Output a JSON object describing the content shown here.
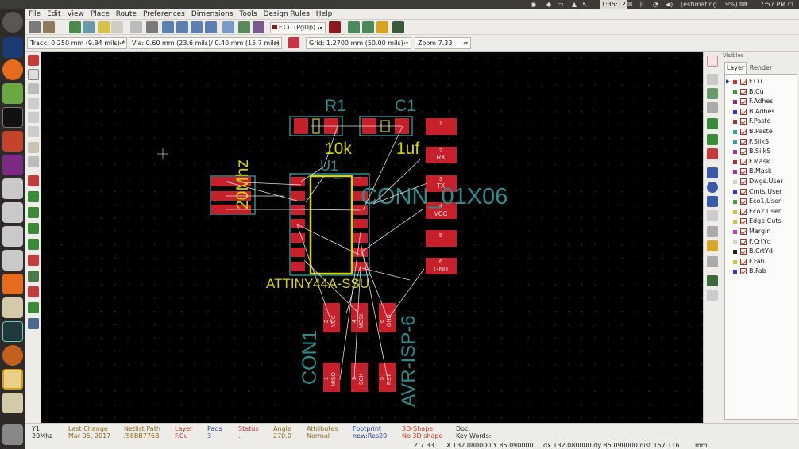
{
  "system_bar": {
    "clock": "1:35:12",
    "status_right": "(estimating... 9%)",
    "time": "7:57 PM"
  },
  "menu": [
    "File",
    "Edit",
    "View",
    "Place",
    "Route",
    "Preferences",
    "Dimensions",
    "Tools",
    "Design Rules",
    "Help"
  ],
  "toolbar": {
    "layer_select": "F.Cu (PgUp)"
  },
  "toolbar2": {
    "track": "Track: 0.250 mm (9.84 mils) *",
    "via": "Via: 0.60 mm (23.6 mils)/ 0.40 mm (15.7 mils) *",
    "grid": "Grid: 1.2700 mm (50.00 mils)",
    "zoom": "Zoom 7.33"
  },
  "pcb": {
    "r1_ref": "R1",
    "r1_value": "10k",
    "c1_ref": "C1",
    "c1_value": "1uf",
    "u1_ref": "U1",
    "u1_value": "ATTINY44A-SSU",
    "y1_value": "20Mhz",
    "conn_value": "CONN_01X06",
    "isp_value": "AVR-ISP-6",
    "con1_ref": "CON1",
    "pad_gnd": "GND",
    "pad_vcc": "VCC",
    "pad_rx": "RX",
    "pad_tx": "TX",
    "pad_gnd2": "GND",
    "conn_pins": [
      "1",
      "2",
      "3",
      "4",
      "5",
      "6"
    ],
    "isp_top": [
      {
        "num": "2",
        "label": "VCC"
      },
      {
        "num": "4",
        "label": "MOSI"
      },
      {
        "num": "6",
        "label": "GND"
      }
    ],
    "isp_bottom": [
      {
        "num": "1",
        "label": "MISO"
      },
      {
        "num": "3",
        "label": "SCK"
      },
      {
        "num": "5",
        "label": "RST"
      }
    ]
  },
  "visibles": {
    "title": "Visibles",
    "tab_layer": "Layer",
    "tab_render": "Render",
    "layers": [
      {
        "name": "F.Cu",
        "color": "#c83434"
      },
      {
        "name": "B.Cu",
        "color": "#349a34"
      },
      {
        "name": "F.Adhes",
        "color": "#8f2a8f"
      },
      {
        "name": "B.Adhes",
        "color": "#3434c8"
      },
      {
        "name": "F.Paste",
        "color": "#a03434"
      },
      {
        "name": "B.Paste",
        "color": "#34a0a0"
      },
      {
        "name": "F.SilkS",
        "color": "#34a0a0"
      },
      {
        "name": "B.SilkS",
        "color": "#a034a0"
      },
      {
        "name": "F.Mask",
        "color": "#a03434"
      },
      {
        "name": "B.Mask",
        "color": "#a034a0"
      },
      {
        "name": "Dwgs.User",
        "color": "#d0d0d0"
      },
      {
        "name": "Cmts.User",
        "color": "#3434c8"
      },
      {
        "name": "Eco1.User",
        "color": "#34a034"
      },
      {
        "name": "Eco2.User",
        "color": "#c8c834"
      },
      {
        "name": "Edge.Cuts",
        "color": "#c8c834"
      },
      {
        "name": "Margin",
        "color": "#c834c8"
      },
      {
        "name": "F.CrtYd",
        "color": "#d0d0d0"
      },
      {
        "name": "B.CrtYd",
        "color": "#202020"
      },
      {
        "name": "F.Fab",
        "color": "#c8c834"
      },
      {
        "name": "B.Fab",
        "color": "#3434c8"
      }
    ]
  },
  "status": {
    "ref_label": "Y1",
    "ref_value": "20Mhz",
    "change_label": "Last Change",
    "change_value": "Mar 05, 2017",
    "netlist_label": "Netlist Path",
    "netlist_value": "/58BB776B",
    "layer_label": "Layer",
    "layer_value": "F.Cu",
    "pads_label": "Pads",
    "pads_value": "3",
    "status_label": "Status",
    "status_value": "..",
    "angle_label": "Angle",
    "angle_value": "270.0",
    "attr_label": "Attributes",
    "attr_value": "Normal",
    "fp_label": "Footprint",
    "fp_value": "new:Res20",
    "shape_label": "3D-Shape",
    "shape_value": "No 3D shape",
    "doc_label": "Doc:",
    "keywords_label": "Key Words:",
    "z": "Z 7.33",
    "xy": "X 132.080000  Y 85.090000",
    "dxdy": "dx 132.080000  dy 85.090000  dist 157.116",
    "unit": "mm"
  }
}
